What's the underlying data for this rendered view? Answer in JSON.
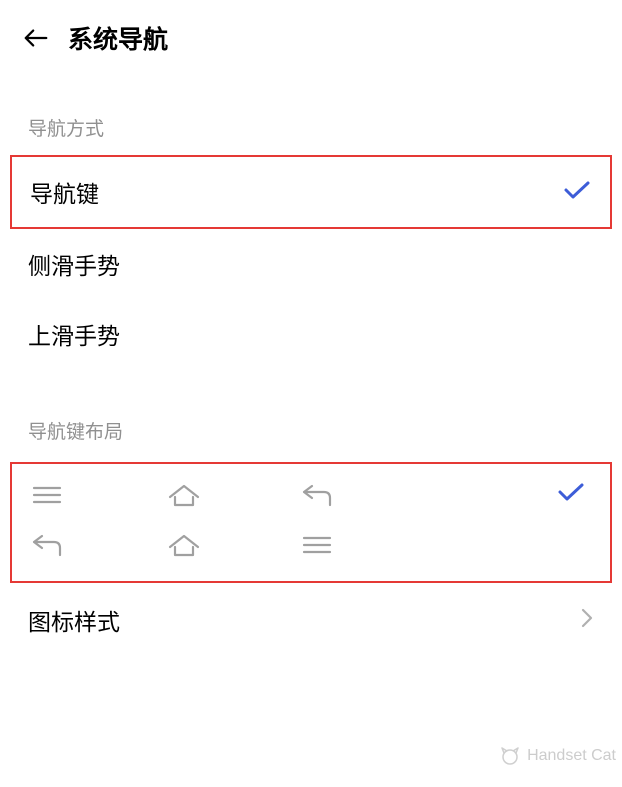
{
  "header": {
    "title": "系统导航"
  },
  "sections": {
    "nav_method_label": "导航方式",
    "nav_key_layout_label": "导航键布局"
  },
  "options": {
    "nav_keys": "导航键",
    "side_swipe": "侧滑手势",
    "up_swipe": "上滑手势",
    "icon_style": "图标样式"
  },
  "watermark": {
    "text": "Handset Cat"
  }
}
